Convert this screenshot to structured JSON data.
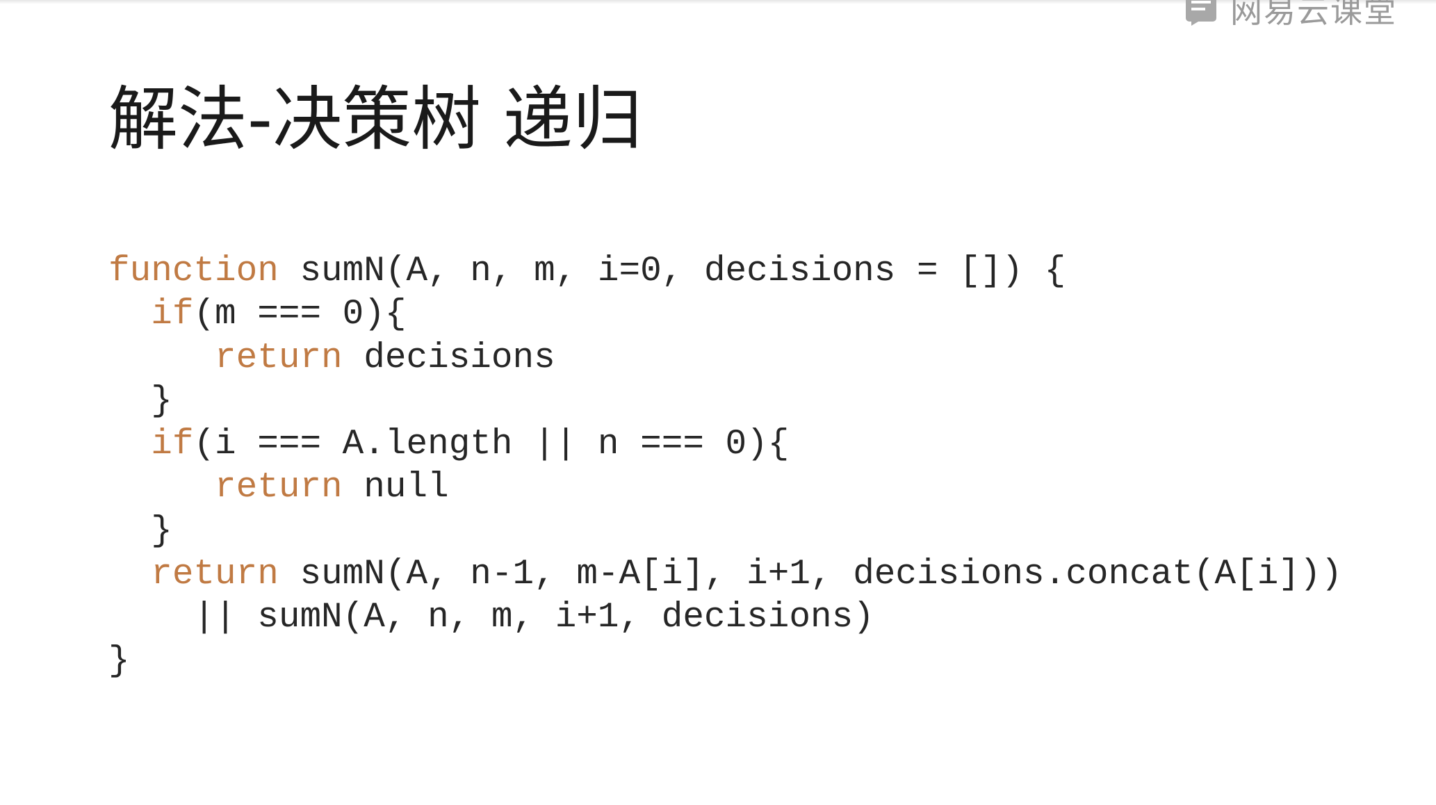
{
  "watermark": {
    "text": "网易云课堂",
    "icon": "book-icon"
  },
  "slide": {
    "title": "解法-决策树 递归"
  },
  "colors": {
    "keyword": "#c07a43",
    "code_text": "#262626",
    "title_text": "#1a1a1a",
    "watermark": "#9a9a9a"
  },
  "code": {
    "lines": [
      {
        "indent": "",
        "kw": "function",
        "rest": " sumN(A, n, m, i=0, decisions = []) {"
      },
      {
        "indent": "  ",
        "kw": "if",
        "rest": "(m === 0){"
      },
      {
        "indent": "     ",
        "kw": "return",
        "rest": " decisions"
      },
      {
        "indent": "  ",
        "kw": "",
        "rest": "}"
      },
      {
        "indent": "  ",
        "kw": "if",
        "rest": "(i === A.length || n === 0){"
      },
      {
        "indent": "     ",
        "kw": "return",
        "rest": " null"
      },
      {
        "indent": "  ",
        "kw": "",
        "rest": "}"
      },
      {
        "indent": "  ",
        "kw": "return",
        "rest": " sumN(A, n-1, m-A[i], i+1, decisions.concat(A[i]))"
      },
      {
        "indent": "    ",
        "kw": "",
        "rest": "|| sumN(A, n, m, i+1, decisions)"
      },
      {
        "indent": "",
        "kw": "",
        "rest": "}"
      }
    ]
  }
}
